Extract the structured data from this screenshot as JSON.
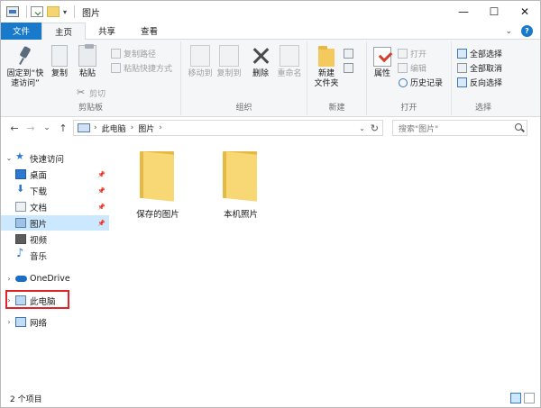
{
  "window": {
    "title": "图片",
    "controls": {
      "minimize": "—",
      "maximize": "☐",
      "close": "✕"
    }
  },
  "qat": {
    "dropdown": "▾"
  },
  "tabs": [
    {
      "label": "文件"
    },
    {
      "label": "主页"
    },
    {
      "label": "共享"
    },
    {
      "label": "查看"
    }
  ],
  "ribbon": {
    "clipboard": {
      "label": "剪贴板",
      "pin": "固定到“快\n速访问”",
      "copy": "复制",
      "paste": "粘贴",
      "copy_path": "复制路径",
      "paste_shortcut": "粘贴快捷方式",
      "cut": "剪切"
    },
    "organize": {
      "label": "组织",
      "move_to": "移动到",
      "copy_to": "复制到",
      "delete": "删除",
      "rename": "重命名"
    },
    "new": {
      "label": "新建",
      "new_folder": "新建\n文件夹"
    },
    "open": {
      "label": "打开",
      "properties": "属性",
      "open": "打开",
      "edit": "编辑",
      "history": "历史记录"
    },
    "select": {
      "label": "选择",
      "select_all": "全部选择",
      "select_none": "全部取消",
      "invert": "反向选择"
    }
  },
  "address": {
    "crumbs": [
      "此电脑",
      "图片"
    ],
    "sep": "›",
    "search_placeholder": "搜索\"图片\""
  },
  "nav": {
    "back": "←",
    "forward": "→",
    "recent": "⌄",
    "up": "↑",
    "items": [
      {
        "label": "快速访问",
        "expander": "⌄"
      },
      {
        "label": "桌面"
      },
      {
        "label": "下载"
      },
      {
        "label": "文档"
      },
      {
        "label": "图片"
      },
      {
        "label": "视频"
      },
      {
        "label": "音乐"
      },
      {
        "label": "OneDrive",
        "expander": "›"
      },
      {
        "label": "此电脑",
        "expander": "›"
      },
      {
        "label": "网络",
        "expander": "›"
      }
    ]
  },
  "files": [
    {
      "label": "保存的图片"
    },
    {
      "label": "本机照片"
    }
  ],
  "status": {
    "text": "2 个项目"
  }
}
